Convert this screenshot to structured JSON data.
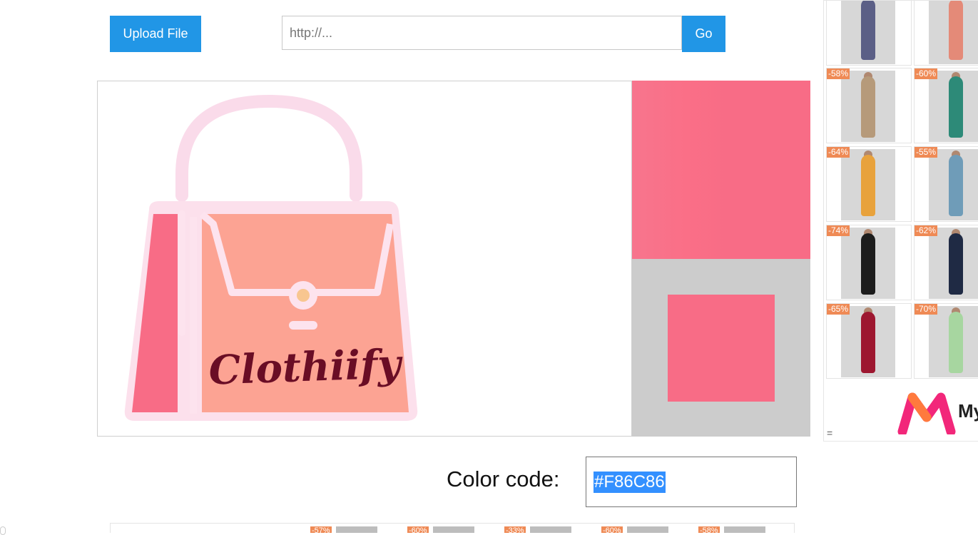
{
  "toolbar": {
    "upload_label": "Upload File",
    "url_placeholder": "http://...",
    "go_label": "Go"
  },
  "preview": {
    "logo_text": "Clothiify"
  },
  "result": {
    "color_label": "Color code:",
    "color_code": "#F86C86",
    "swatch_color": "#F86C86"
  },
  "ad": {
    "products": [
      {
        "badge": ""
      },
      {
        "badge": ""
      },
      {
        "badge": "-58%"
      },
      {
        "badge": "-60%"
      },
      {
        "badge": "-64%"
      },
      {
        "badge": "-55%"
      },
      {
        "badge": "-74%"
      },
      {
        "badge": "-62%"
      },
      {
        "badge": "-65%"
      },
      {
        "badge": "-70%"
      }
    ],
    "logo_text": "My",
    "menu_glyph": "="
  },
  "bottom_ad": {
    "badges": [
      "-57%",
      "-60%",
      "-33%",
      "-60%",
      "-58%"
    ]
  }
}
